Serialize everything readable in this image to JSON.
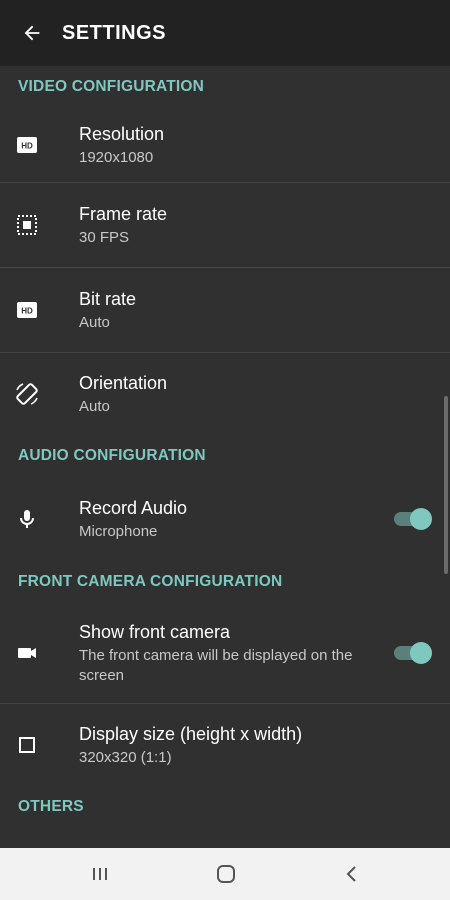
{
  "header": {
    "title": "SETTINGS",
    "back_icon": "arrow-back-icon"
  },
  "colors": {
    "accent": "#7ec8c0",
    "background": "#303030",
    "appbar": "#222222"
  },
  "sections": {
    "video": {
      "header": "VIDEO CONFIGURATION",
      "items": [
        {
          "title": "Resolution",
          "value": "1920x1080",
          "icon": "hd-icon"
        },
        {
          "title": "Frame rate",
          "value": "30 FPS",
          "icon": "frame-rate-icon"
        },
        {
          "title": "Bit rate",
          "value": "Auto",
          "icon": "hd-icon"
        },
        {
          "title": "Orientation",
          "value": "Auto",
          "icon": "screen-rotation-icon"
        }
      ]
    },
    "audio": {
      "header": "AUDIO CONFIGURATION",
      "items": [
        {
          "title": "Record Audio",
          "value": "Microphone",
          "icon": "microphone-icon",
          "toggle_on": true
        }
      ]
    },
    "front_camera": {
      "header": "FRONT CAMERA CONFIGURATION",
      "items": [
        {
          "title": "Show front camera",
          "value": "The front camera will be displayed on the screen",
          "icon": "videocam-icon",
          "toggle_on": true
        },
        {
          "title": "Display size (height x width)",
          "value": "320x320 (1:1)",
          "icon": "square-icon"
        }
      ]
    },
    "others": {
      "header": "OTHERS"
    }
  },
  "navbar": {
    "recent_icon": "recent-apps-icon",
    "home_icon": "home-icon",
    "back_icon": "nav-back-icon"
  }
}
